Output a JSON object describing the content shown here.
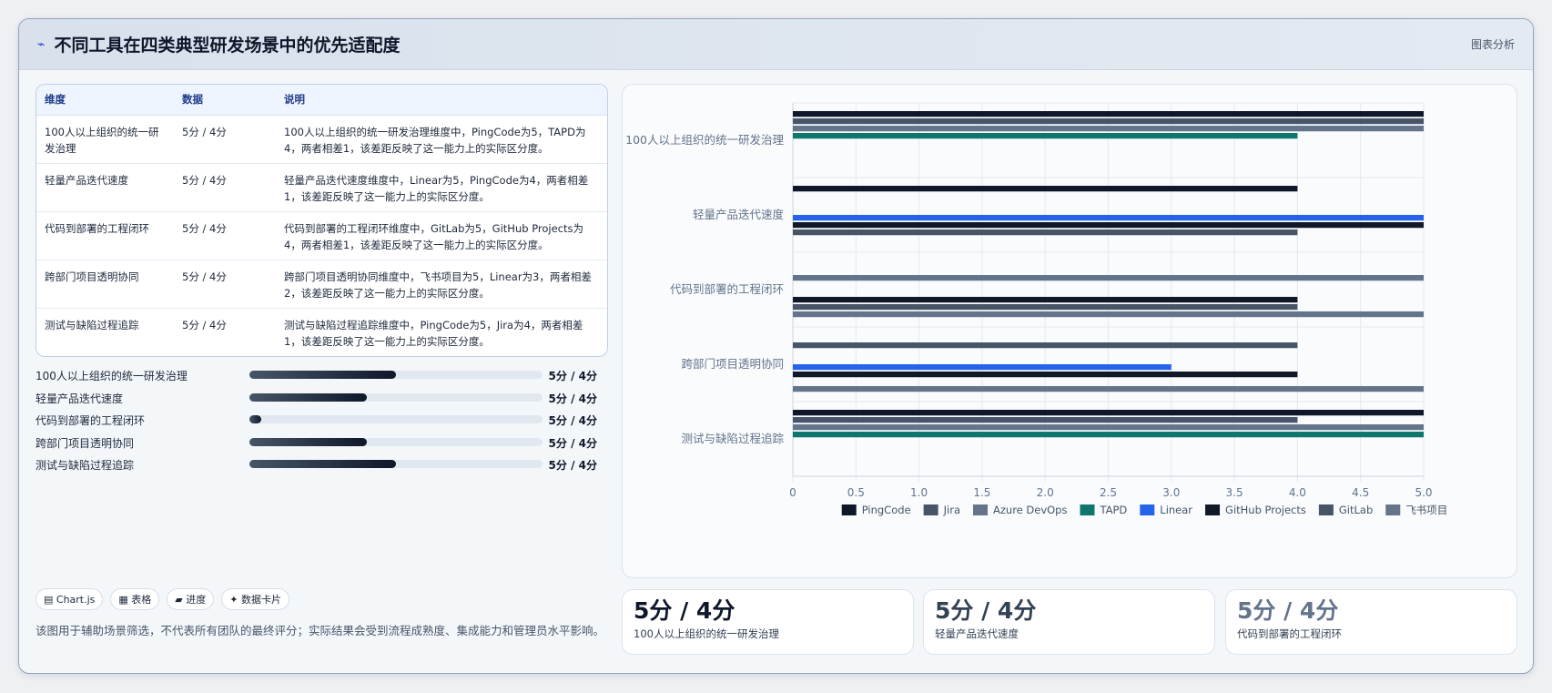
{
  "header": {
    "icon": "pulse-icon",
    "title": "不同工具在四类典型研发场景中的优先适配度",
    "tag": "图表分析"
  },
  "table": {
    "headers": [
      "维度",
      "数据",
      "说明"
    ],
    "rows": [
      [
        "100人以上组织的统一研发治理",
        "5分 / 4分",
        "100人以上组织的统一研发治理维度中，PingCode为5，TAPD为4，两者相差1，该差距反映了这一能力上的实际区分度。"
      ],
      [
        "轻量产品迭代速度",
        "5分 / 4分",
        "轻量产品迭代速度维度中，Linear为5，PingCode为4，两者相差1，该差距反映了这一能力上的实际区分度。"
      ],
      [
        "代码到部署的工程闭环",
        "5分 / 4分",
        "代码到部署的工程闭环维度中，GitLab为5，GitHub Projects为4，两者相差1，该差距反映了这一能力上的实际区分度。"
      ],
      [
        "跨部门项目透明协同",
        "5分 / 4分",
        "跨部门项目透明协同维度中，飞书项目为5，Linear为3，两者相差2，该差距反映了这一能力上的实际区分度。"
      ],
      [
        "测试与缺陷过程追踪",
        "5分 / 4分",
        "测试与缺陷过程追踪维度中，PingCode为5，Jira为4，两者相差1，该差距反映了这一能力上的实际区分度。"
      ]
    ]
  },
  "progress": [
    {
      "label": "100人以上组织的统一研发治理",
      "value": "5分 / 4分",
      "fill": 0.5
    },
    {
      "label": "轻量产品迭代速度",
      "value": "5分 / 4分",
      "fill": 0.4
    },
    {
      "label": "代码到部署的工程闭环",
      "value": "5分 / 4分",
      "fill": 0.04
    },
    {
      "label": "跨部门项目透明协同",
      "value": "5分 / 4分",
      "fill": 0.4
    },
    {
      "label": "测试与缺陷过程追踪",
      "value": "5分 / 4分",
      "fill": 0.5
    }
  ],
  "chips": [
    "▤ Chart.js",
    "▦ 表格",
    "▰ 进度",
    "✦ 数据卡片"
  ],
  "note": "该图用于辅助场景筛选，不代表所有团队的最终评分；实际结果会受到流程成熟度、集成能力和管理员水平影响。",
  "stats": [
    {
      "big": "5分 / 4分",
      "sub": "100人以上组织的统一研发治理",
      "color": "#0f172a"
    },
    {
      "big": "5分 / 4分",
      "sub": "轻量产品迭代速度",
      "color": "#334155"
    },
    {
      "big": "5分 / 4分",
      "sub": "代码到部署的工程闭环",
      "color": "#64748b"
    }
  ],
  "chart_data": {
    "type": "bar",
    "orientation": "horizontal",
    "categories": [
      "100人以上组织的统一研发治理",
      "轻量产品迭代速度",
      "代码到部署的工程闭环",
      "跨部门项目透明协同",
      "测试与缺陷过程追踪"
    ],
    "series": [
      {
        "name": "PingCode",
        "color": "#0f172a",
        "values": [
          5,
          4,
          0,
          0,
          5
        ]
      },
      {
        "name": "Jira",
        "color": "#475569",
        "values": [
          5,
          0,
          0,
          4,
          4
        ]
      },
      {
        "name": "Azure DevOps",
        "color": "#64748b",
        "values": [
          5,
          0,
          5,
          0,
          5
        ]
      },
      {
        "name": "TAPD",
        "color": "#0f766e",
        "values": [
          4,
          0,
          0,
          0,
          5
        ]
      },
      {
        "name": "Linear",
        "color": "#2563eb",
        "values": [
          0,
          5,
          0,
          3,
          0
        ]
      },
      {
        "name": "GitHub Projects",
        "color": "#111827",
        "values": [
          0,
          5,
          4,
          4,
          0
        ]
      },
      {
        "name": "GitLab",
        "color": "#475569",
        "values": [
          0,
          4,
          4,
          0,
          0
        ]
      },
      {
        "name": "飞书项目",
        "color": "#64748b",
        "values": [
          0,
          0,
          5,
          5,
          0
        ]
      }
    ],
    "xlim": [
      0,
      5
    ],
    "xticks": [
      "0",
      "0.5",
      "1.0",
      "1.5",
      "2.0",
      "2.5",
      "3.0",
      "3.5",
      "4.0",
      "4.5",
      "5.0"
    ],
    "grid": true,
    "legend": "bottom"
  }
}
